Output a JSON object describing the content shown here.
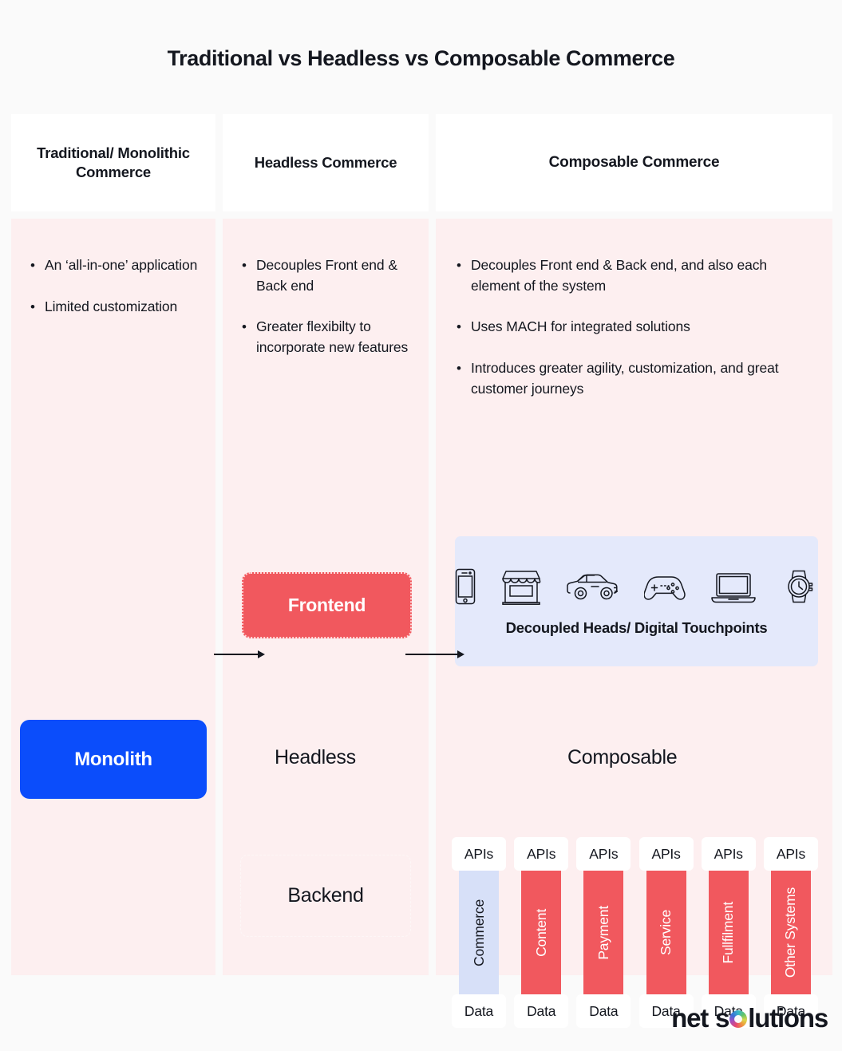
{
  "page": {
    "title": "Traditional vs Headless vs Composable Commerce",
    "background_color": "#fafafa"
  },
  "colors": {
    "accent_blue": "#0b4dfb",
    "accent_red": "#f1585e",
    "column_bg": "#fdeff0",
    "panel_blue": "#e4e9fb",
    "commerce_blue": "#d7e0f8",
    "text": "#14171f"
  },
  "columns": [
    {
      "header": "Traditional/ Monolithic Commerce",
      "bullets": [
        "An ‘all-in-one’ application",
        "Limited customization"
      ]
    },
    {
      "header": "Headless Commerce",
      "bullets": [
        "Decouples Front end &  Back end",
        "Greater flexibilty to incorporate new features"
      ]
    },
    {
      "header": "Composable Commerce",
      "bullets": [
        "Decouples Front end &  Back end, and also each element of the system",
        "Uses MACH for integrated solutions",
        "Introduces greater agility, customization, and great customer journeys"
      ]
    }
  ],
  "boxes": {
    "monolith": "Monolith",
    "frontend": "Frontend",
    "backend": "Backend"
  },
  "stage_labels": {
    "headless": "Headless",
    "composable": "Composable"
  },
  "touchpoints": {
    "label": "Decoupled Heads/ Digital Touchpoints",
    "icons": [
      "smartphone-icon",
      "storefront-icon",
      "car-icon",
      "gamepad-icon",
      "laptop-icon",
      "smartwatch-icon"
    ]
  },
  "api_stack": {
    "top_label": "APIs",
    "bottom_label": "Data",
    "services": [
      {
        "name": "Commerce",
        "style": "blue"
      },
      {
        "name": "Content",
        "style": "red"
      },
      {
        "name": "Payment",
        "style": "red"
      },
      {
        "name": "Service",
        "style": "red"
      },
      {
        "name": "Fullfilment",
        "style": "red"
      },
      {
        "name": "Other Systems",
        "style": "red"
      }
    ]
  },
  "logo": {
    "word1": "net",
    "word2_part1": "s",
    "word2_part2": "lutions"
  }
}
